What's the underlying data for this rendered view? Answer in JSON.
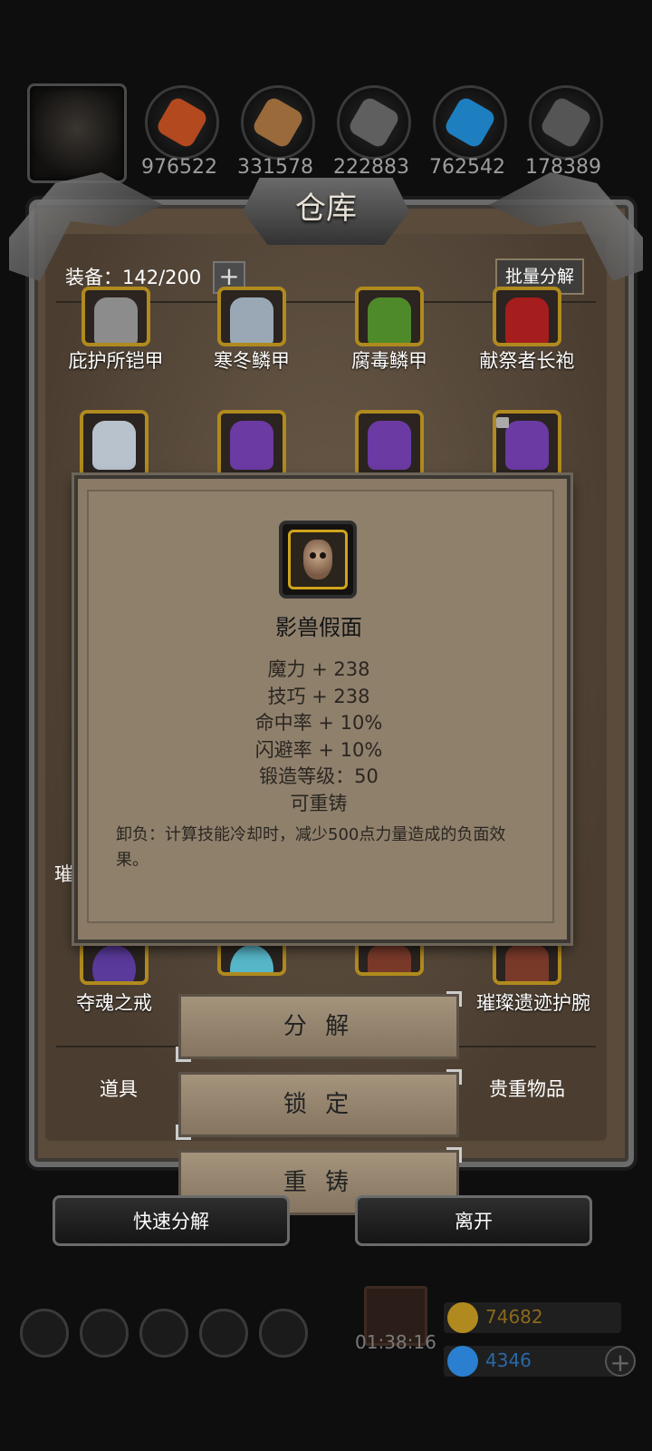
{
  "resources": [
    {
      "value": "976522",
      "color": "#b3491f"
    },
    {
      "value": "331578",
      "color": "#9a6a3a"
    },
    {
      "value": "222883",
      "color": "#5f5f5f"
    },
    {
      "value": "762542",
      "color": "#1e7fc0"
    },
    {
      "value": "178389",
      "color": "#555555"
    }
  ],
  "window": {
    "title": "仓库",
    "equip_label": "装备：142/200",
    "add_label": "+",
    "bulk_label": "批量分解"
  },
  "items_row1": [
    {
      "name": "庇护所铠甲",
      "color": "#8c8c8c"
    },
    {
      "name": "寒冬鳞甲",
      "color": "#9aa7b5"
    },
    {
      "name": "腐毒鳞甲",
      "color": "#4f8a2a"
    },
    {
      "name": "献祭者长袍",
      "color": "#a61d1d"
    }
  ],
  "items_row2_colors": [
    "#b8c2cc",
    "#6b3aa3",
    "#6b3aa3",
    "#6b3aa3"
  ],
  "partial_label": "璀",
  "items_last": [
    {
      "name": "夺魂之戒",
      "color": "#5a3a9a"
    },
    {
      "name": "",
      "color": "#57b8c9"
    },
    {
      "name": "",
      "color": "#7a3a2a"
    },
    {
      "name": "璀璨遗迹护腕",
      "color": "#7a3a2a"
    }
  ],
  "tooltip": {
    "name": "影兽假面",
    "stats": [
      "魔力 + 238",
      "技巧 + 238",
      "命中率 + 10%",
      "闪避率 + 10%",
      "锻造等级：50",
      "可重铸"
    ],
    "desc": "卸负：计算技能冷却时，减少500点力量造成的负面效果。"
  },
  "actions": {
    "decompose": "分 解",
    "lock": "锁 定",
    "recast": "重 铸"
  },
  "tabs": {
    "props": "道具",
    "valuables": "贵重物品"
  },
  "bottom": {
    "quick_decompose": "快速分解",
    "leave": "离开"
  },
  "hud": {
    "timer": "01:38:16",
    "gold": "74682",
    "gems": "4346",
    "gold_color": "#b08a1e",
    "gem_color": "#2a7fd0"
  }
}
